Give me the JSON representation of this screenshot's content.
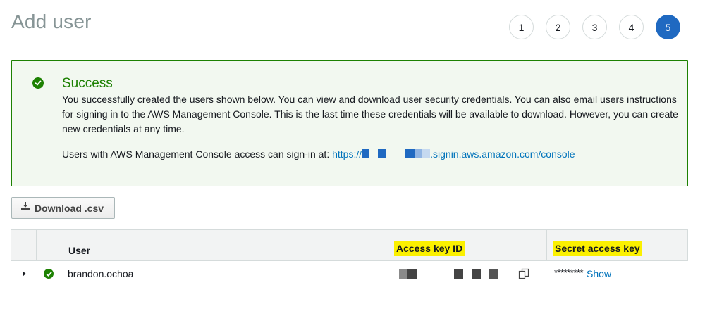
{
  "header": {
    "title": "Add user"
  },
  "steps": [
    {
      "label": "1",
      "active": false
    },
    {
      "label": "2",
      "active": false
    },
    {
      "label": "3",
      "active": false
    },
    {
      "label": "4",
      "active": false
    },
    {
      "label": "5",
      "active": true
    }
  ],
  "alert": {
    "title": "Success",
    "body": "You successfully created the users shown below. You can view and download user security credentials. You can also email users instructions for signing in to the AWS Management Console. This is the last time these credentials will be available to download. However, you can create new credentials at any time.",
    "signin_prefix": "Users with AWS Management Console access can sign-in at: ",
    "signin_url_start": "https://",
    "signin_url_end": ".signin.aws.amazon.com/console"
  },
  "toolbar": {
    "download_label": "Download .csv"
  },
  "table": {
    "columns": {
      "user": "User",
      "access_key": "Access key ID",
      "secret_key": "Secret access key"
    },
    "rows": [
      {
        "user": "brandon.ochoa",
        "secret_masked": "*********",
        "show_label": "Show"
      }
    ]
  },
  "colors": {
    "accent": "#1f69c1",
    "success": "#1d8102",
    "link": "#0073bb",
    "highlight": "#fbf000"
  }
}
